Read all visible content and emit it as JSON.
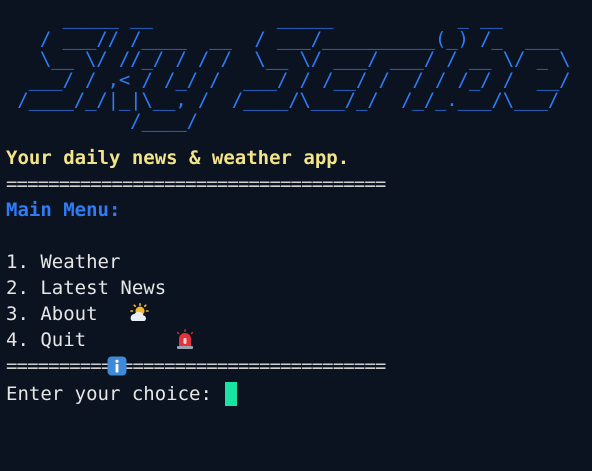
{
  "logo": {
    "ascii": [
      "     _____ __           _____           _ __       ",
      "   / ___// /____  __  / ___/__________(_) /_  ___ ",
      "   \\__ \\/ //_/ / / /  \\__ \\/ ___/ ___/ / __ \\/ _ \\",
      "  ___/ / ,< / /_/ /  ___/ / /__/ /  / / /_/ /  __/",
      " /____/_/|_|\\__, /  /____/\\___/_/  /_/_.___/\\___/ ",
      "           /____/                                  "
    ]
  },
  "tagline": "Your daily news & weather app.",
  "rule": "====================================",
  "menu": {
    "title": "Main Menu:",
    "items": [
      {
        "label": "1. Weather",
        "icon": "sun-behind-cloud-icon"
      },
      {
        "label": "2. Latest News",
        "icon": "siren-icon"
      },
      {
        "label": "3. About",
        "icon": "info-icon"
      },
      {
        "label": "4. Quit",
        "icon": ""
      }
    ]
  },
  "prompt": {
    "text": "Enter your choice: "
  },
  "colors": {
    "background": "#0b1220",
    "ascii": "#2f7cf6",
    "tagline": "#f2e48a",
    "text": "#e6e6e6",
    "cursor": "#19e3a0"
  }
}
